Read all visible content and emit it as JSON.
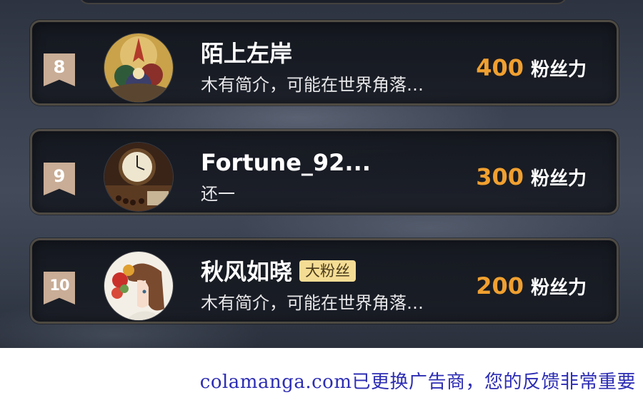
{
  "ranking": [
    {
      "rank": "8",
      "name": "陌上左岸",
      "badge": "",
      "bio": "木有简介，可能在世界角落…",
      "score": "400",
      "unit": "粉丝力",
      "avatar": "avatar-illustration-icon"
    },
    {
      "rank": "9",
      "name": "Fortune_92...",
      "badge": "",
      "bio": "还一",
      "score": "300",
      "unit": "粉丝力",
      "avatar": "clock-photo-icon"
    },
    {
      "rank": "10",
      "name": "秋风如晓",
      "badge": "大粉丝",
      "bio": "木有简介，可能在世界角落…",
      "score": "200",
      "unit": "粉丝力",
      "avatar": "anime-girl-icon"
    }
  ],
  "footer": {
    "notice": "colamanga.com已更换广告商，您的反馈非常重要"
  },
  "colors": {
    "score": "#f0a030",
    "badge_bg": "#f4dc94",
    "rank_ribbon": "#c9ad96",
    "footer_text": "#2d2db4"
  }
}
